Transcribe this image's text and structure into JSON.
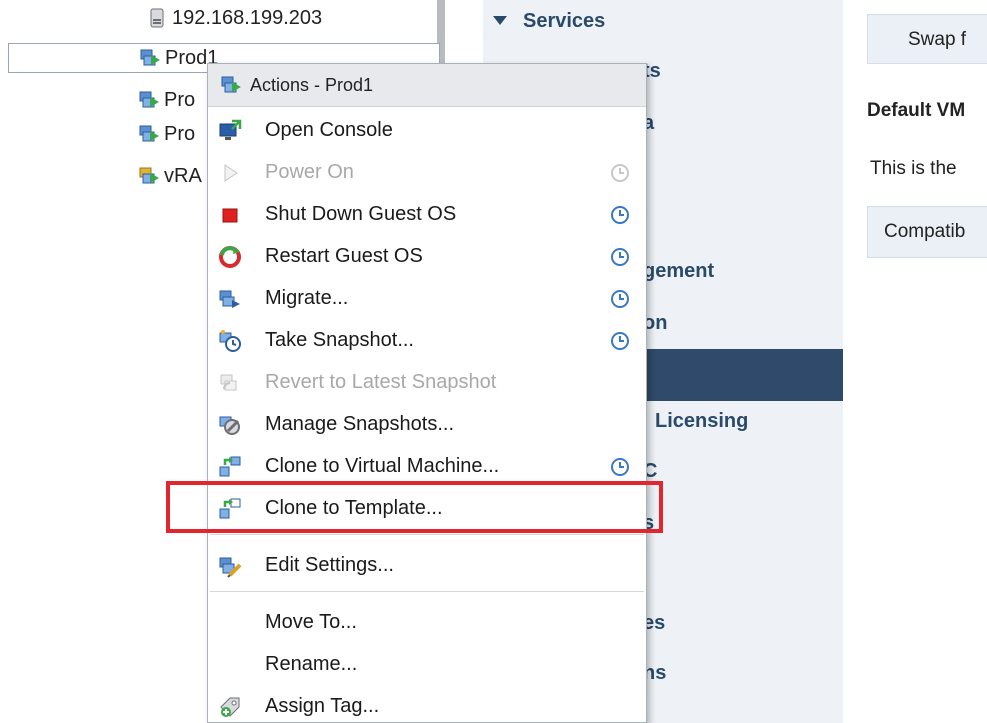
{
  "tree": {
    "host_label": "192.168.199.203",
    "prod1_label": "Prod1",
    "prod2_label": "Pro",
    "prod3_label": "Pro",
    "vra_label": "vRA"
  },
  "services": {
    "heading": "Services",
    "items": [
      "ts",
      "a",
      "gement",
      "on",
      "Licensing",
      "C",
      "s",
      "es",
      "ns"
    ]
  },
  "right": {
    "swap_button": "Swap f",
    "default_vm": "Default VM",
    "this_is": "This is the",
    "compat": "Compatib"
  },
  "menu": {
    "header": "Actions - Prod1",
    "items": [
      {
        "label": "Open Console",
        "icon": "console-icon"
      },
      {
        "label": "Power On",
        "icon": "power-on-icon"
      },
      {
        "label": "Shut Down Guest OS",
        "icon": "shutdown-icon"
      },
      {
        "label": "Restart Guest OS",
        "icon": "restart-icon"
      },
      {
        "label": "Migrate...",
        "icon": "migrate-icon"
      },
      {
        "label": "Take Snapshot...",
        "icon": "snapshot-icon"
      },
      {
        "label": "Revert to Latest Snapshot",
        "icon": "revert-snapshot-icon"
      },
      {
        "label": "Manage Snapshots...",
        "icon": "manage-snapshots-icon"
      },
      {
        "label": "Clone to Virtual Machine...",
        "icon": "clone-vm-icon"
      },
      {
        "label": "Clone to Template...",
        "icon": "clone-template-icon"
      },
      {
        "label": "Edit Settings...",
        "icon": "edit-settings-icon"
      },
      {
        "label": "Move To...",
        "icon": ""
      },
      {
        "label": "Rename...",
        "icon": ""
      },
      {
        "label": "Assign Tag...",
        "icon": "assign-tag-icon"
      }
    ]
  },
  "colors": {
    "highlight": "#e3262d",
    "selected_service": "#2f4a6a",
    "clock": "#3b78c4"
  }
}
